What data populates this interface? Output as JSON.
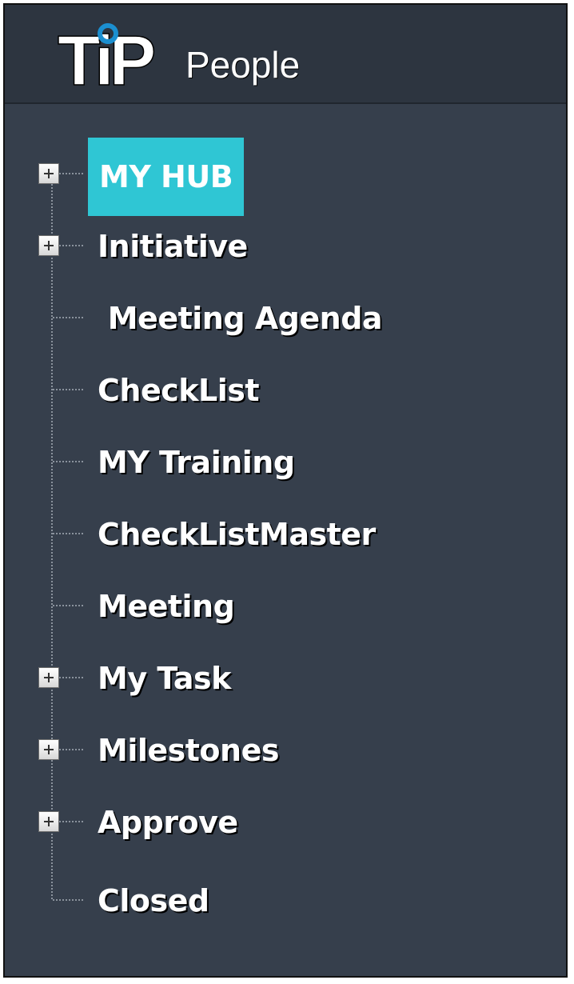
{
  "app": {
    "logo_text": "TiP",
    "title": "People"
  },
  "colors": {
    "panel_bg": "#363f4c",
    "header_bg": "#2d3540",
    "selected_bg": "#2fc6d4",
    "logo_ring": "#1b8fd0"
  },
  "tree": {
    "items": [
      {
        "label": "MY HUB",
        "expandable": true,
        "selected": true
      },
      {
        "label": "Initiative",
        "expandable": true,
        "selected": false
      },
      {
        "label": " Meeting Agenda",
        "expandable": false,
        "selected": false
      },
      {
        "label": "CheckList",
        "expandable": false,
        "selected": false
      },
      {
        "label": "MY Training",
        "expandable": false,
        "selected": false
      },
      {
        "label": "CheckListMaster",
        "expandable": false,
        "selected": false
      },
      {
        "label": "Meeting",
        "expandable": false,
        "selected": false
      },
      {
        "label": "My Task",
        "expandable": true,
        "selected": false
      },
      {
        "label": "Milestones",
        "expandable": true,
        "selected": false
      },
      {
        "label": "Approve",
        "expandable": true,
        "selected": false
      },
      {
        "label": "Closed",
        "expandable": false,
        "selected": false
      }
    ]
  }
}
